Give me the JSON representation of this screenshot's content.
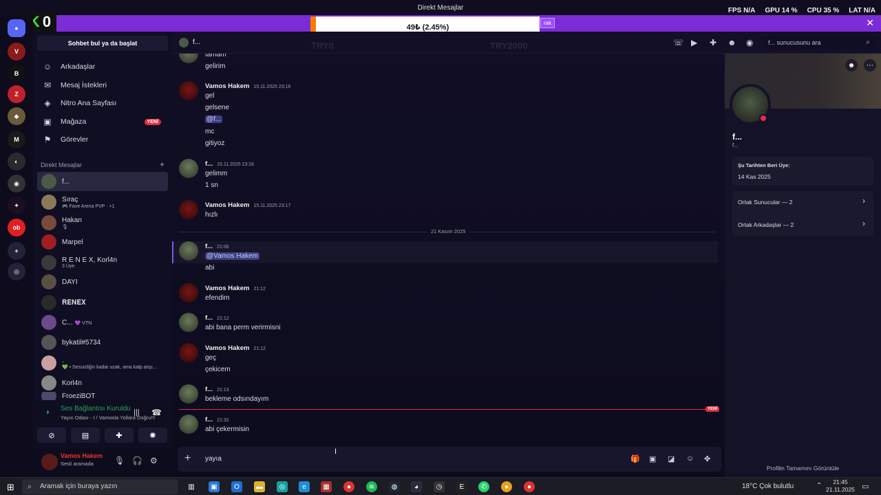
{
  "window": {
    "title": "Direkt Mesajlar"
  },
  "overlay": {
    "fps_label": "FPS",
    "fps_value": "N/A",
    "gpu_label": "GPU",
    "gpu_value": "14 %",
    "cpu_label": "CPU",
    "cpu_value": "35 %",
    "lat_label": "LAT",
    "lat_value": "N/A",
    "ghost_left": "TRY0",
    "ghost_right": "TRY2000",
    "tag": "rak"
  },
  "logo": {
    "k": "K",
    "o": "0"
  },
  "progress": {
    "text": "49₺ (2.45%)",
    "fraction": 0.0245
  },
  "sidebar": {
    "search_label": "Sohbet bul ya da başlat",
    "nav": [
      {
        "label": "Arkadaşlar",
        "icon": "friends-icon"
      },
      {
        "label": "Mesaj İstekleri",
        "icon": "mail-icon"
      },
      {
        "label": "Nitro Ana Sayfası",
        "icon": "nitro-icon"
      },
      {
        "label": "Mağaza",
        "icon": "shop-icon",
        "badge": "YENİ"
      },
      {
        "label": "Görevler",
        "icon": "quests-icon"
      }
    ],
    "dm_header": "Direkt Mesajlar",
    "dms": [
      {
        "name": "f...",
        "sub": ""
      },
      {
        "name": "Sıraç",
        "sub": "🎮 Fave Arena PVP · +1"
      },
      {
        "name": "Hakan",
        "sub": "🎙"
      },
      {
        "name": "Marpel",
        "sub": ""
      },
      {
        "name": "R E N E X, Korl4n",
        "sub": "3 Üye"
      },
      {
        "name": "DAYI",
        "sub": ""
      },
      {
        "name": "𝐑𝐄𝐍𝐄𝐗",
        "sub": ""
      },
      {
        "name": "C...",
        "sub": "💜 VTN"
      },
      {
        "name": "bykatil#5734",
        "sub": ""
      },
      {
        "name": ".",
        "sub": "💚 • Sessizliğin kadar uzak, ama kalp atışı..."
      },
      {
        "name": "Korl4n",
        "sub": ""
      },
      {
        "name": "FroeziBOT",
        "sub": ""
      }
    ]
  },
  "voice": {
    "status": "Ses Bağlantısı Kuruldu",
    "room": "Yayın Odası - I / Vamosla Yollara Doğru!!!"
  },
  "user": {
    "name": "Vamos Hakem",
    "status": "Sesli aramada"
  },
  "chat": {
    "header_name": "f...",
    "search_placeholder": "f... sunucusunu ara",
    "date_divider": "21 Kasım 2025",
    "new_badge": "YENİ",
    "input_value": "yayıa",
    "messages": [
      {
        "lines": [
          "tamam",
          "gelirim"
        ]
      },
      {
        "author": "Vamos Hakem",
        "time": "15.11.2025 23:16",
        "lines": [
          "gel",
          "gelsene",
          "@f...",
          "mc",
          "gitiyoz"
        ]
      },
      {
        "author": "f...",
        "time": "15.11.2025 23:16",
        "lines": [
          "gelimm",
          "1 sn"
        ]
      },
      {
        "author": "Vamos Hakem",
        "time": "15.11.2025 23:17",
        "lines": [
          "hızlı"
        ]
      },
      {
        "author": "f...",
        "time": "21:06",
        "lines": [
          "@Vamos Hakem",
          "abi"
        ]
      },
      {
        "author": "Vamos Hakem",
        "time": "21:12",
        "lines": [
          "efendim"
        ]
      },
      {
        "author": "f...",
        "time": "21:12",
        "lines": [
          "abi bana perm verirmisni"
        ]
      },
      {
        "author": "Vamos Hakem",
        "time": "21:12",
        "lines": [
          "geç",
          "çekicem"
        ]
      },
      {
        "author": "f...",
        "time": "21:13",
        "lines": [
          "bekleme odsındayım"
        ]
      },
      {
        "author": "f...",
        "time": "21:32",
        "lines": [
          "abi çekermisin"
        ]
      }
    ]
  },
  "profile": {
    "name": "f...",
    "username": "f...",
    "member_since_label": "Şu Tarihten Beri Üye:",
    "member_since": "14 Kas 2025",
    "mutual_servers": "Ortak Sunucular — 2",
    "mutual_friends": "Ortak Arkadaşlar — 2",
    "full_profile": "Profilin Tamamını Görüntüle"
  },
  "taskbar": {
    "search_placeholder": "Aramak için buraya yazın",
    "weather": "18°C  Çok bulutlu",
    "time": "21:45",
    "date": "21.11.2025"
  }
}
